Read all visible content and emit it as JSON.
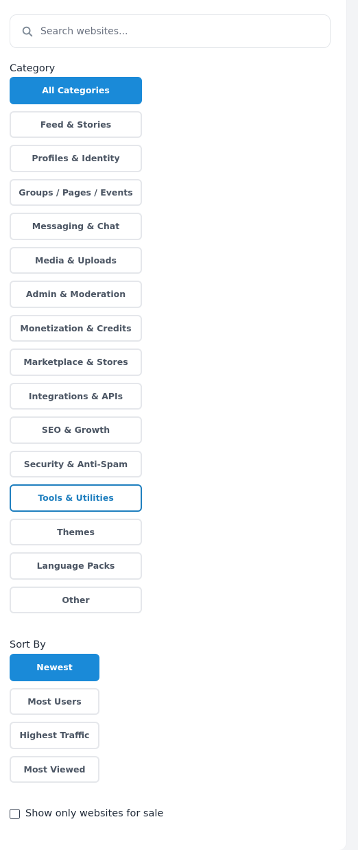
{
  "search": {
    "placeholder": "Search websites...",
    "value": ""
  },
  "category": {
    "label": "Category",
    "items": [
      {
        "label": "All Categories",
        "state": "selected"
      },
      {
        "label": "Feed & Stories",
        "state": "default"
      },
      {
        "label": "Profiles & Identity",
        "state": "default"
      },
      {
        "label": "Groups / Pages / Events",
        "state": "default"
      },
      {
        "label": "Messaging & Chat",
        "state": "default"
      },
      {
        "label": "Media & Uploads",
        "state": "default"
      },
      {
        "label": "Admin & Moderation",
        "state": "default"
      },
      {
        "label": "Monetization & Credits",
        "state": "default"
      },
      {
        "label": "Marketplace & Stores",
        "state": "default"
      },
      {
        "label": "Integrations & APIs",
        "state": "default"
      },
      {
        "label": "SEO & Growth",
        "state": "default"
      },
      {
        "label": "Security & Anti-Spam",
        "state": "default"
      },
      {
        "label": "Tools & Utilities",
        "state": "focused"
      },
      {
        "label": "Themes",
        "state": "default"
      },
      {
        "label": "Language Packs",
        "state": "default"
      },
      {
        "label": "Other",
        "state": "default"
      }
    ]
  },
  "sort": {
    "label": "Sort By",
    "items": [
      {
        "label": "Newest",
        "state": "selected"
      },
      {
        "label": "Most Users",
        "state": "default"
      },
      {
        "label": "Highest Traffic",
        "state": "default"
      },
      {
        "label": "Most Viewed",
        "state": "default"
      }
    ]
  },
  "for_sale_filter": {
    "label": "Show only websites for sale",
    "checked": false
  },
  "colors": {
    "accent": "#1a8ad8",
    "focus_border": "#1f7fbf",
    "button_border": "#e5e7eb",
    "button_text": "#4b5563"
  }
}
